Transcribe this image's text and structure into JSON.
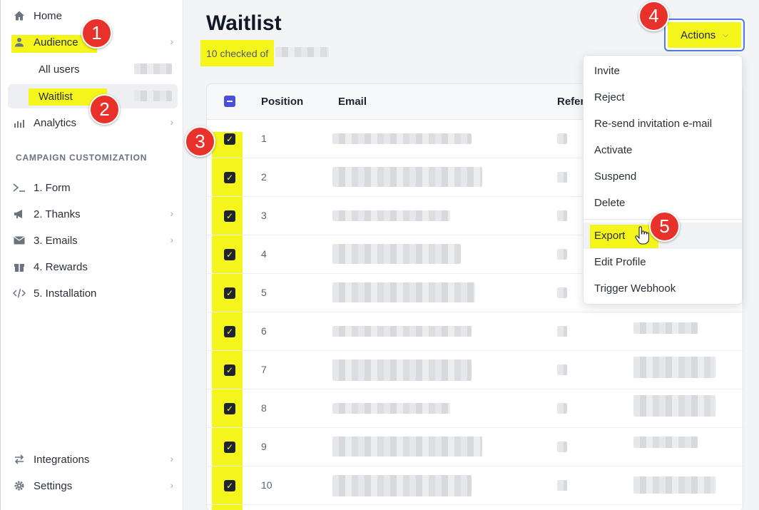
{
  "sidebar": {
    "home": "Home",
    "audience": "Audience",
    "all_users": "All users",
    "waitlist": "Waitlist",
    "analytics": "Analytics",
    "section_label": "CAMPAIGN CUSTOMIZATION",
    "form": "1. Form",
    "thanks": "2. Thanks",
    "emails": "3. Emails",
    "rewards": "4. Rewards",
    "installation": "5. Installation",
    "integrations": "Integrations",
    "settings": "Settings"
  },
  "page": {
    "title": "Waitlist",
    "checked_text": "10 checked of",
    "actions_label": "Actions"
  },
  "table": {
    "headers": {
      "position": "Position",
      "email": "Email",
      "referrals": "Refer"
    },
    "positions": [
      "1",
      "2",
      "3",
      "4",
      "5",
      "6",
      "7",
      "8",
      "9",
      "10"
    ]
  },
  "menu": {
    "items": [
      "Invite",
      "Reject",
      "Re-send invitation e-mail",
      "Activate",
      "Suspend",
      "Delete",
      "Export",
      "Edit Profile",
      "Trigger Webhook"
    ]
  },
  "markers": [
    "1",
    "2",
    "3",
    "4",
    "5"
  ],
  "colors": {
    "highlight": "#f4f51a",
    "marker": "#e8312b",
    "accent": "#4b4fd8"
  }
}
